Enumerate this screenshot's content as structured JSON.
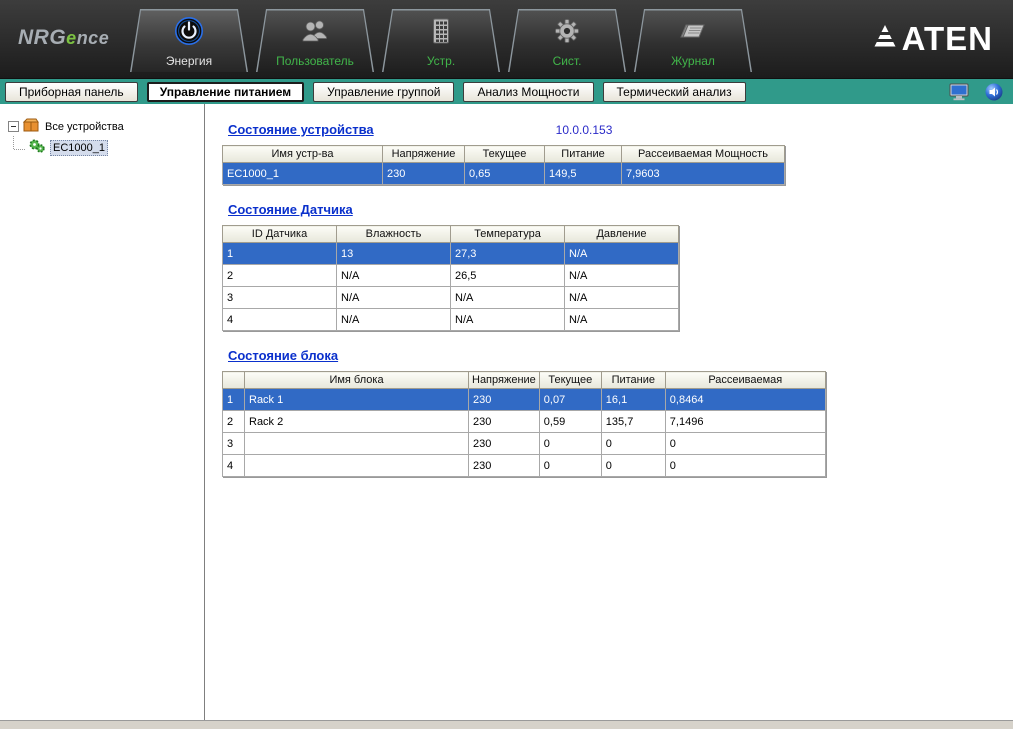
{
  "header": {
    "logo": {
      "nrg": "NRG",
      "e": "e",
      "nce": "nce"
    },
    "brand": "ATEN",
    "tabs": [
      {
        "label": "Энергия",
        "icon": "power-icon",
        "active": true
      },
      {
        "label": "Пользователь",
        "icon": "users-icon",
        "active": false
      },
      {
        "label": "Устр.",
        "icon": "devices-icon",
        "active": false
      },
      {
        "label": "Сист.",
        "icon": "system-gear-icon",
        "active": false
      },
      {
        "label": "Журнал",
        "icon": "journal-icon",
        "active": false
      }
    ]
  },
  "subnav": {
    "buttons": [
      {
        "label": "Приборная панель",
        "active": false
      },
      {
        "label": "Управление питанием",
        "active": true
      },
      {
        "label": "Управление группой",
        "active": false
      },
      {
        "label": "Анализ Мощности",
        "active": false
      },
      {
        "label": "Термический анализ",
        "active": false
      }
    ],
    "icons": [
      "monitor-icon",
      "speaker-icon"
    ]
  },
  "sidebar": {
    "root_label": "Все устройства",
    "device_label": "EC1000_1"
  },
  "main": {
    "ip_address": "10.0.0.153",
    "device_status": {
      "title": "Состояние устройства",
      "columns": [
        "Имя устр-ва",
        "Напряжение",
        "Текущее",
        "Питание",
        "Рассеиваемая Мощность"
      ],
      "rows": [
        [
          "EC1000_1",
          "230",
          "0,65",
          "149,5",
          "7,9603"
        ]
      ],
      "highlight_row": 0
    },
    "sensor_status": {
      "title": "Состояние Датчика",
      "columns": [
        "ID Датчика",
        "Влажность",
        "Температура",
        "Давление"
      ],
      "rows": [
        [
          "1",
          "13",
          "27,3",
          "N/A"
        ],
        [
          "2",
          "N/A",
          "26,5",
          "N/A"
        ],
        [
          "3",
          "N/A",
          "N/A",
          "N/A"
        ],
        [
          "4",
          "N/A",
          "N/A",
          "N/A"
        ]
      ],
      "highlight_row": 0
    },
    "bank_status": {
      "title": "Состояние блока",
      "columns": [
        "",
        "Имя блока",
        "Напряжение",
        "Текущее",
        "Питание",
        "Рассеиваемая"
      ],
      "rows": [
        [
          "1",
          "Rack 1",
          "230",
          "0,07",
          "16,1",
          "0,8464"
        ],
        [
          "2",
          "Rack 2",
          "230",
          "0,59",
          "135,7",
          "7,1496"
        ],
        [
          "3",
          "",
          "230",
          "0",
          "0",
          "0"
        ],
        [
          "4",
          "",
          "230",
          "0",
          "0",
          "0"
        ]
      ],
      "highlight_row": 0
    }
  },
  "colors": {
    "subnav_teal": "#309a8a",
    "row_highlight_blue": "#316ac5",
    "heading_blue": "#0a30cc",
    "tab_green": "#41b54a",
    "logo_green": "#7cc242"
  }
}
